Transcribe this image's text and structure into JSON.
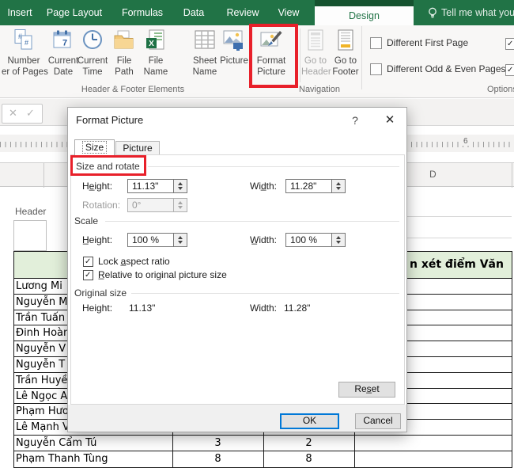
{
  "icons": {
    "check": "✓",
    "cancel": "✕",
    "enter": "✓",
    "help": "?",
    "close": "✕"
  },
  "ribbon": {
    "tabs": [
      {
        "label": "Insert"
      },
      {
        "label": "Page Layout"
      },
      {
        "label": "Formulas"
      },
      {
        "label": "Data"
      },
      {
        "label": "Review"
      },
      {
        "label": "View"
      },
      {
        "label": "Design"
      }
    ],
    "tell_me": "Tell me what you w",
    "buttons": {
      "number_of_pages": {
        "line1": "Number",
        "line2": "er of Pages"
      },
      "current_date": {
        "line1": "Current",
        "line2": "Date"
      },
      "current_time": {
        "line1": "Current",
        "line2": "Time"
      },
      "file_path": {
        "line1": "File",
        "line2": "Path"
      },
      "file_name": {
        "line1": "File",
        "line2": "Name"
      },
      "sheet_name": {
        "line1": "Sheet",
        "line2": "Name"
      },
      "picture": {
        "line1": "Picture"
      },
      "format_picture": {
        "line1": "Format",
        "line2": "Picture"
      },
      "go_to_header": {
        "line1": "Go to",
        "line2": "Header"
      },
      "go_to_footer": {
        "line1": "Go to",
        "line2": "Footer"
      }
    },
    "options": {
      "different_first_page": "Different First Page",
      "different_odd_even": "Different Odd & Even Pages"
    },
    "groups": {
      "elements": "Header & Footer Elements",
      "navigation": "Navigation",
      "options": "Options"
    }
  },
  "dialog": {
    "title": "Format Picture",
    "tabs": [
      {
        "label": "Size"
      },
      {
        "label": "Picture"
      }
    ],
    "size_rotate": {
      "heading": "Size and rotate",
      "height_label": "He̲ight:",
      "height_value": "11.13\"",
      "width_label": "Wid̲th:",
      "width_value": "11.28\"",
      "rotation_label": "Rotation:",
      "rotation_value": "0°"
    },
    "scale": {
      "heading": "Scale",
      "height_label": "H̲eight:",
      "height_value": "100 %",
      "width_label": "W̲idth:",
      "width_value": "100 %",
      "lock": "Lock a̲spect ratio",
      "relative": "R̲elative to original picture size"
    },
    "original": {
      "heading": "Original size",
      "height_label": "Height:",
      "height_value": "11.13\"",
      "width_label": "Width:",
      "width_value": "11.28\""
    },
    "buttons": {
      "reset": "Res̲et",
      "ok": "OK",
      "cancel": "Cancel"
    }
  },
  "ruler": {
    "number": "6"
  },
  "columns": {
    "d": "D"
  },
  "sheet": {
    "header_label": "Header",
    "table_header": "n xét điểm Văn",
    "rows": [
      "Lương Mi",
      "Nguyễn M",
      "Trần Tuấn",
      "Đinh Hoàn",
      "Nguyễn V",
      "Nguyễn T",
      "Trần Huyề",
      "Lê Ngọc A",
      "Phạm Hươ",
      "Lê Mạnh V"
    ],
    "bottom_rows": [
      {
        "name": "Nguyễn Cẩm Tú",
        "v1": "3",
        "v2": "2"
      },
      {
        "name": "Phạm Thanh Tùng",
        "v1": "8",
        "v2": "8"
      }
    ]
  }
}
